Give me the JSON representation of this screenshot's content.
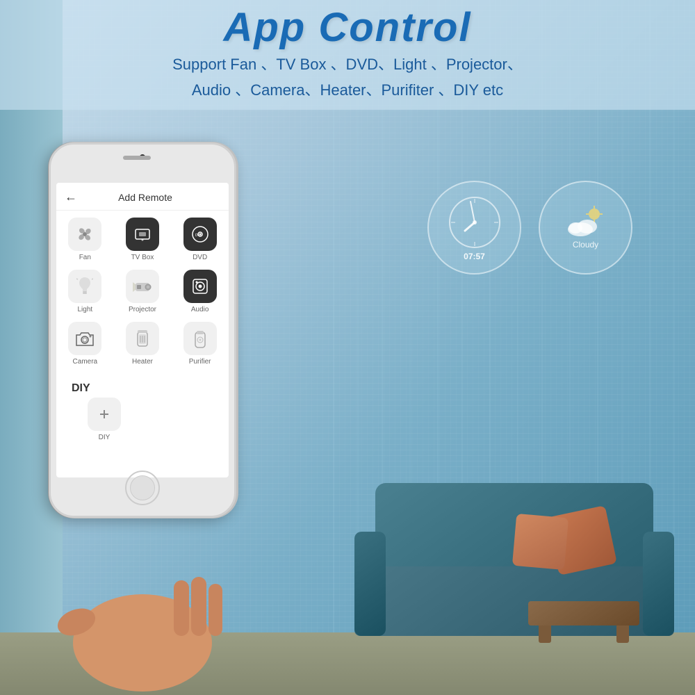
{
  "page": {
    "title": "App Control",
    "subtitle_line1": "Support Fan 、TV Box 、DVD、Light 、Projector、",
    "subtitle_line2": "Audio 、Camera、Heater、Purifiter 、DIY etc"
  },
  "clock": {
    "time": "07:57",
    "label": "Clock"
  },
  "weather": {
    "condition": "Cloudy",
    "icon": "⛅"
  },
  "app": {
    "header": {
      "back_icon": "←",
      "title": "Add Remote"
    },
    "sections": [
      {
        "title": "",
        "items": [
          {
            "label": "Fan",
            "icon": "🌀",
            "icon_style": "light"
          },
          {
            "label": "TV Box",
            "icon": "📺",
            "icon_style": "dark"
          },
          {
            "label": "DVD",
            "icon": "💿",
            "icon_style": "dark"
          }
        ]
      },
      {
        "title": "",
        "items": [
          {
            "label": "Light",
            "icon": "💡",
            "icon_style": "light"
          },
          {
            "label": "Projector",
            "icon": "📽",
            "icon_style": "light"
          },
          {
            "label": "Audio",
            "icon": "🔊",
            "icon_style": "dark"
          }
        ]
      },
      {
        "title": "",
        "items": [
          {
            "label": "Camera",
            "icon": "📷",
            "icon_style": "light"
          },
          {
            "label": "Heater",
            "icon": "🌡",
            "icon_style": "light"
          },
          {
            "label": "Purifier",
            "icon": "💨",
            "icon_style": "light"
          }
        ]
      },
      {
        "title": "DIY",
        "items": [
          {
            "label": "DIY",
            "icon": "🔧",
            "icon_style": "light"
          }
        ]
      }
    ]
  }
}
